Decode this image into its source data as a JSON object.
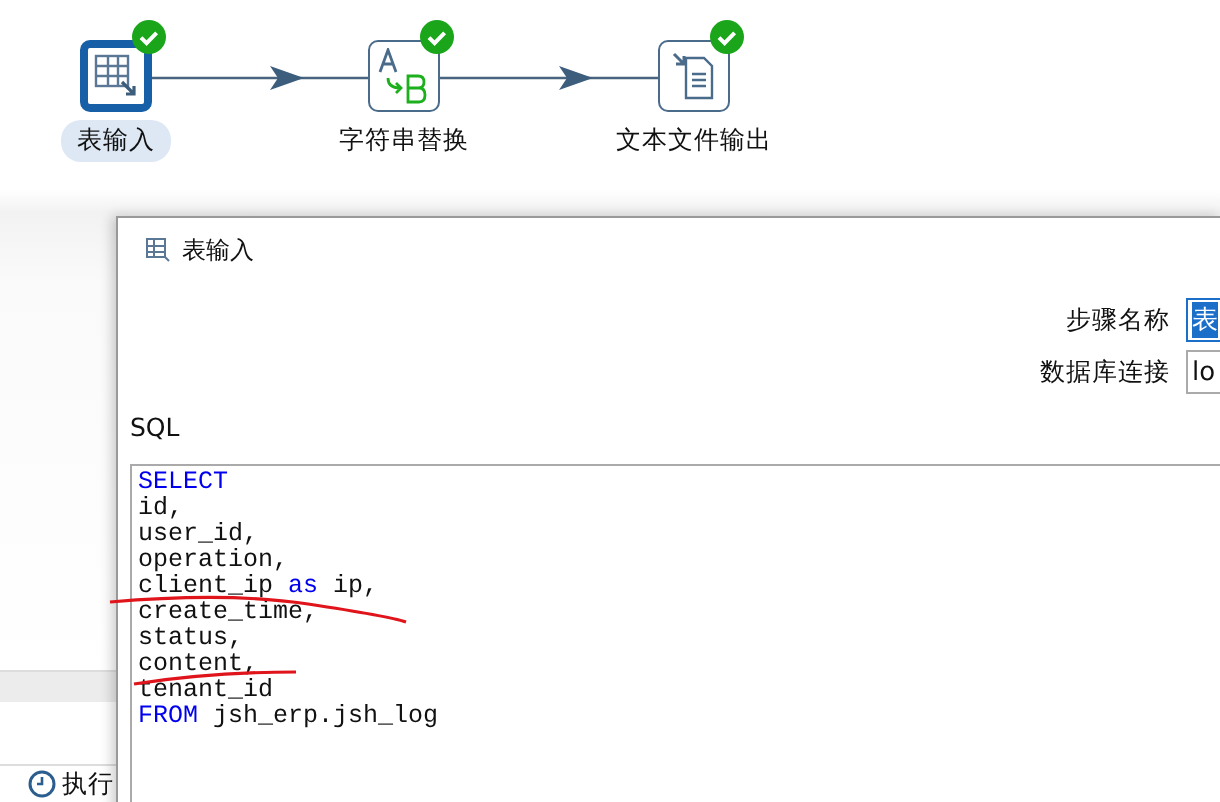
{
  "canvas": {
    "nodes": [
      {
        "label": "表输入",
        "kind": "table",
        "selected": true,
        "ok": true
      },
      {
        "label": "字符串替换",
        "kind": "replace",
        "selected": false,
        "ok": true
      },
      {
        "label": "文本文件输出",
        "kind": "file",
        "selected": false,
        "ok": true
      }
    ]
  },
  "bottom_panel": {
    "tabs": [
      {
        "label": "执行",
        "selected": true
      }
    ]
  },
  "dialog": {
    "title": "表输入",
    "fields": [
      {
        "label": "步骤名称",
        "value": "表",
        "text_selected": true
      },
      {
        "label": "数据库连接",
        "value": "lo",
        "text_selected": false
      }
    ],
    "sql_label": "SQL",
    "sql_lines": [
      [
        {
          "text": "SELECT",
          "kind": "keyword"
        }
      ],
      [
        {
          "text": "id,",
          "kind": "plain"
        }
      ],
      [
        {
          "text": "user_id,",
          "kind": "plain"
        }
      ],
      [
        {
          "text": "operation,",
          "kind": "plain"
        }
      ],
      [
        {
          "text": "client_ip ",
          "kind": "plain"
        },
        {
          "text": "as",
          "kind": "keyword"
        },
        {
          "text": " ip,",
          "kind": "plain"
        }
      ],
      [
        {
          "text": "create_time,",
          "kind": "plain"
        }
      ],
      [
        {
          "text": "status,",
          "kind": "plain"
        }
      ],
      [
        {
          "text": "content,",
          "kind": "plain"
        }
      ],
      [
        {
          "text": "tenant_id",
          "kind": "plain"
        }
      ],
      [
        {
          "text": "FROM",
          "kind": "keyword"
        },
        {
          "text": " jsh_erp.jsh_log",
          "kind": "plain"
        }
      ]
    ]
  }
}
